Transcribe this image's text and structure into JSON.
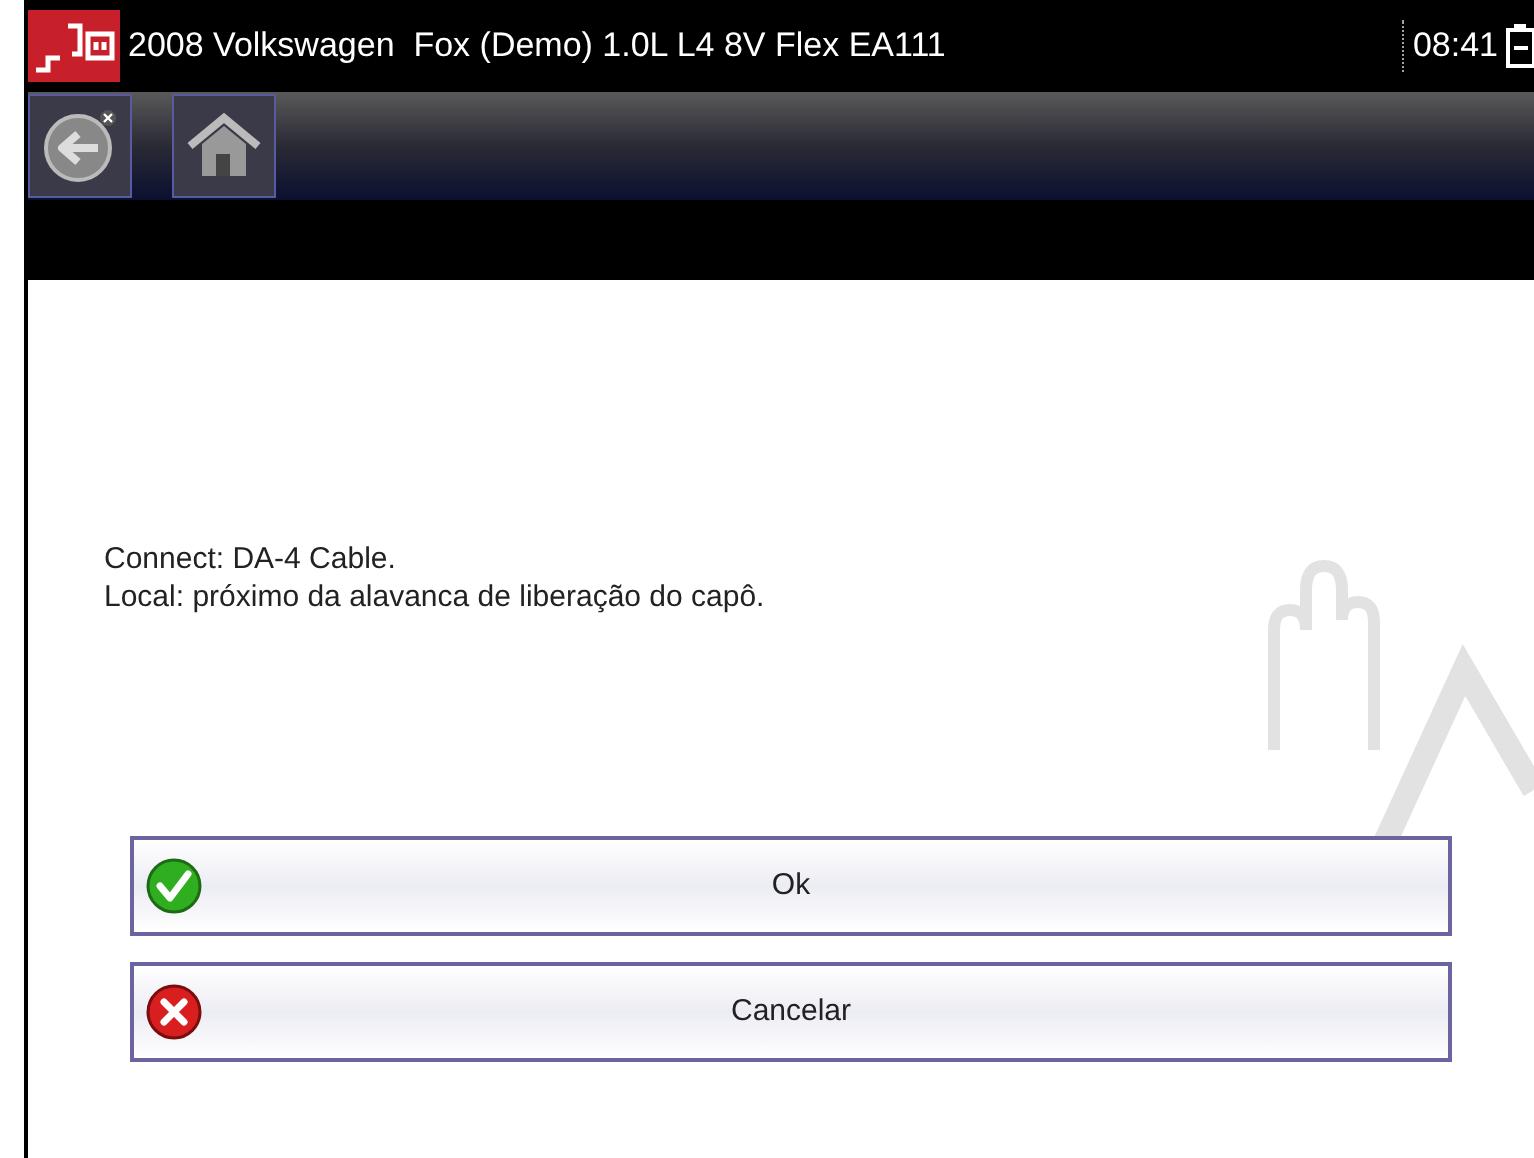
{
  "header": {
    "title": "2008 Volkswagen  Fox (Demo) 1.0L L4 8V Flex EA111",
    "time": "08:41"
  },
  "message": [
    "Connect: DA-4 Cable.",
    "Local: próximo da alavanca de liberação do capô."
  ],
  "buttons": [
    {
      "label": "Ok",
      "kind": "ok"
    },
    {
      "label": "Cancelar",
      "kind": "cancel"
    }
  ]
}
